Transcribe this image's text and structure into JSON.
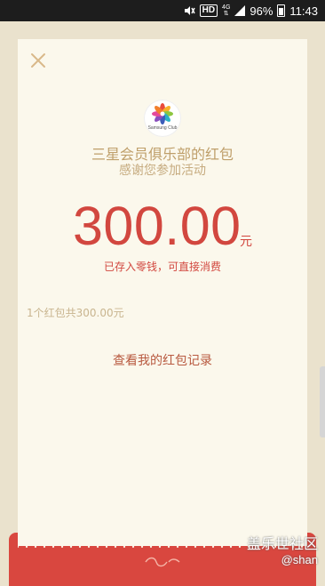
{
  "status_bar": {
    "hd_label": "HD",
    "network_label": "4G",
    "battery": "96%",
    "time": "11:43"
  },
  "envelope": {
    "title": "三星会员俱乐部的红包",
    "subtitle": "感谢您参加活动",
    "amount": "300.00",
    "unit": "元",
    "stored_text": "已存入零钱，可直接消费",
    "summary": "1个红包共300.00元",
    "records_link": "查看我的红包记录",
    "logo_text": "Samsung Club"
  },
  "watermark": {
    "site": "盖乐世社区",
    "user": "@shan"
  },
  "colors": {
    "accent_red": "#d2473f",
    "gold": "#bf9f6a",
    "paper": "#fbf8ec",
    "background": "#eae2cd"
  }
}
